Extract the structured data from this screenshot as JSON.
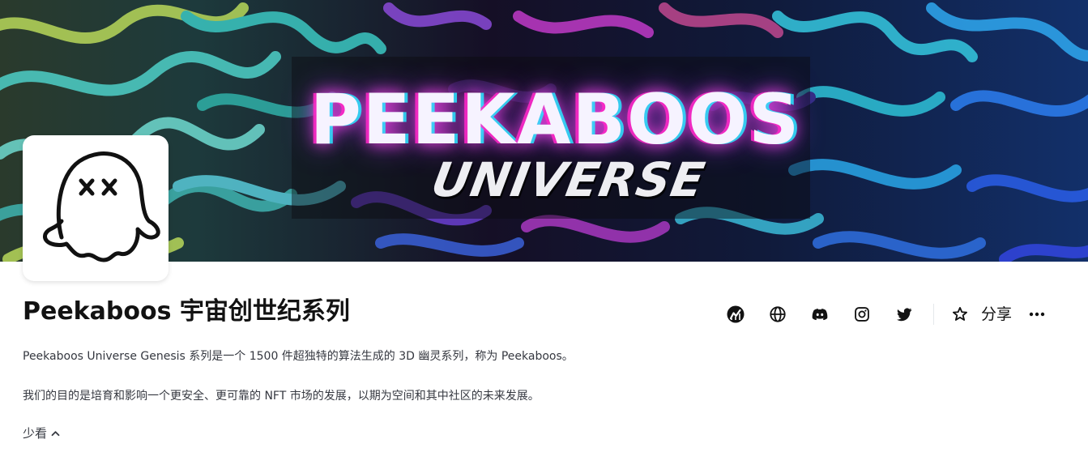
{
  "banner": {
    "title": "PEEKABOOS",
    "subtitle": "UNIVERSE"
  },
  "avatar": {
    "icon": "ghost-icon"
  },
  "collection": {
    "title": "Peekaboos 宇宙创世纪系列",
    "description_lines": [
      "Peekaboos Universe Genesis 系列是一个 1500 件超独特的算法生成的 3D 幽灵系列，称为 Peekaboos。",
      "我们的目的是培育和影响一个更安全、更可靠的 NFT 市场的发展，以期为空间和其中社区的未来发展。"
    ],
    "toggle_label": "少看"
  },
  "actions": {
    "icons": [
      "stats-icon",
      "globe-icon",
      "discord-icon",
      "instagram-icon",
      "twitter-icon",
      "star-icon"
    ],
    "share_label": "分享",
    "more_icon": "more-icon"
  },
  "colors": {
    "text_primary": "#121212",
    "text_secondary": "#353840",
    "divider": "#e5e8eb"
  }
}
